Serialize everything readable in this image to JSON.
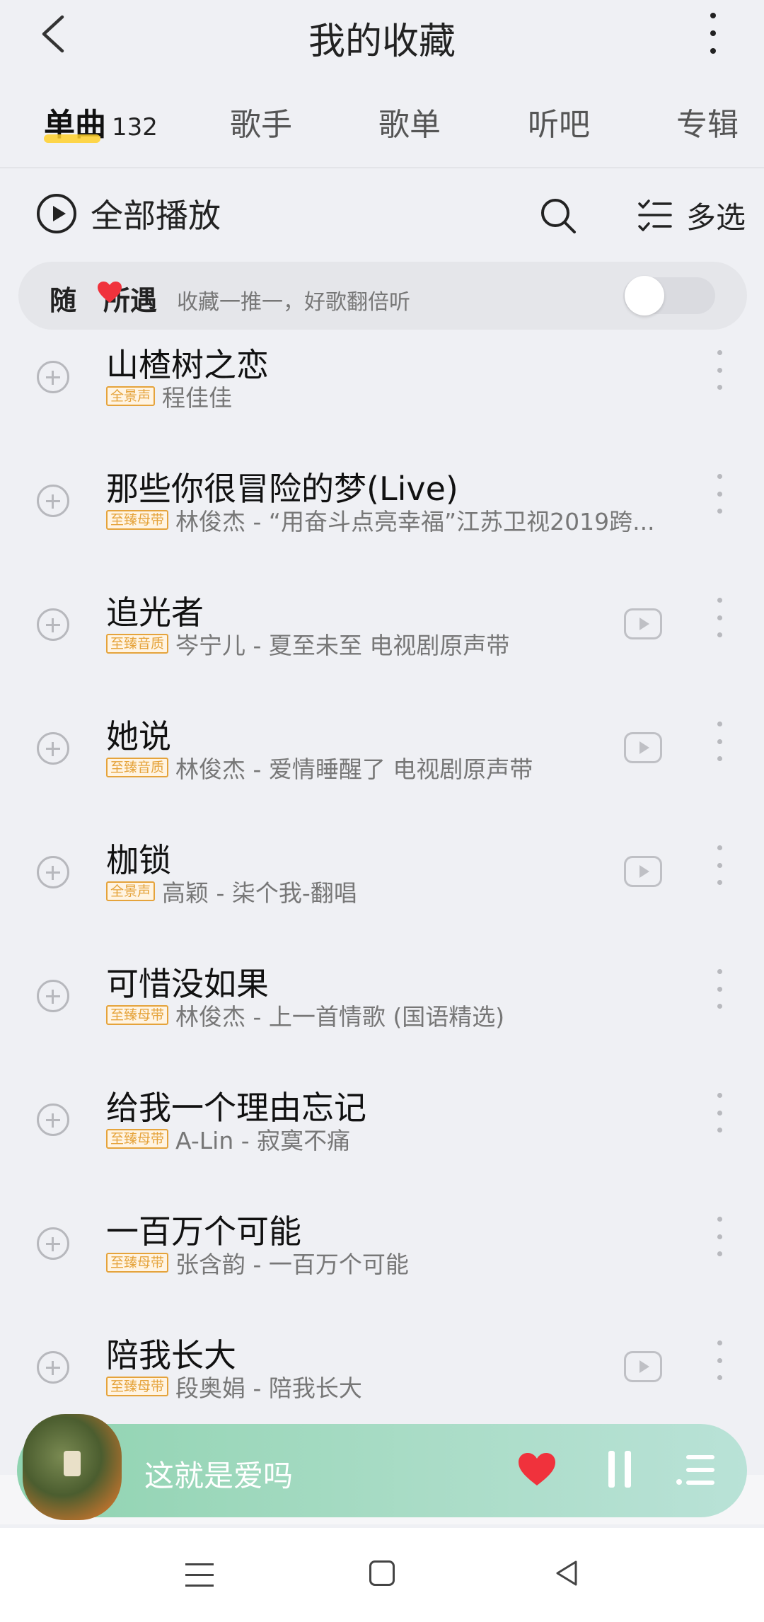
{
  "header": {
    "title": "我的收藏"
  },
  "tabs": [
    {
      "label": "单曲",
      "count": "132",
      "active": true
    },
    {
      "label": "歌手"
    },
    {
      "label": "歌单"
    },
    {
      "label": "听吧"
    },
    {
      "label": "专辑"
    }
  ],
  "actions": {
    "play_all": "全部播放",
    "multi_select": "多选"
  },
  "random_bar": {
    "title_part1": "随",
    "title_part2": "所遇",
    "subtitle": "收藏一推一，好歌翻倍听",
    "toggle_on": false
  },
  "songs": [
    {
      "title": "山楂树之恋",
      "badge": "全景声",
      "subtitle": "程佳佳",
      "has_mv": false
    },
    {
      "title": "那些你很冒险的梦(Live)",
      "badge": "至臻母带",
      "subtitle": "林俊杰 - “用奋斗点亮幸福”江苏卫视2019跨...",
      "has_mv": false
    },
    {
      "title": "追光者",
      "badge": "至臻音质",
      "subtitle": "岑宁儿 - 夏至未至 电视剧原声带",
      "has_mv": true
    },
    {
      "title": "她说",
      "badge": "至臻音质",
      "subtitle": "林俊杰 - 爱情睡醒了 电视剧原声带",
      "has_mv": true
    },
    {
      "title": "枷锁",
      "badge": "全景声",
      "subtitle": "高颖 - 柒个我-翻唱",
      "has_mv": true
    },
    {
      "title": "可惜没如果",
      "badge": "至臻母带",
      "subtitle": "林俊杰 - 上一首情歌 (国语精选)",
      "has_mv": false
    },
    {
      "title": "给我一个理由忘记",
      "badge": "至臻母带",
      "subtitle": "A-Lin - 寂寞不痛",
      "has_mv": false
    },
    {
      "title": "一百万个可能",
      "badge": "至臻母带",
      "subtitle": "张含韵 - 一百万个可能",
      "has_mv": false
    },
    {
      "title": "陪我长大",
      "badge": "至臻母带",
      "subtitle": "段奥娟 - 陪我长大",
      "has_mv": true
    }
  ],
  "player": {
    "title": "这就是爱吗",
    "liked": true
  },
  "colors": {
    "accent_yellow": "#ffd02a",
    "badge_orange": "#e5a33b",
    "heart_red": "#f0323c",
    "player_green": "#8fd3b0"
  },
  "icons": {
    "back": "back-arrow-icon",
    "more": "more-vertical-icon",
    "play": "play-circle-icon",
    "search": "search-icon",
    "multi": "multi-select-icon",
    "add": "add-circle-icon",
    "mv": "mv-play-icon",
    "heart": "heart-icon",
    "pause": "pause-icon",
    "playlist": "playlist-icon"
  }
}
